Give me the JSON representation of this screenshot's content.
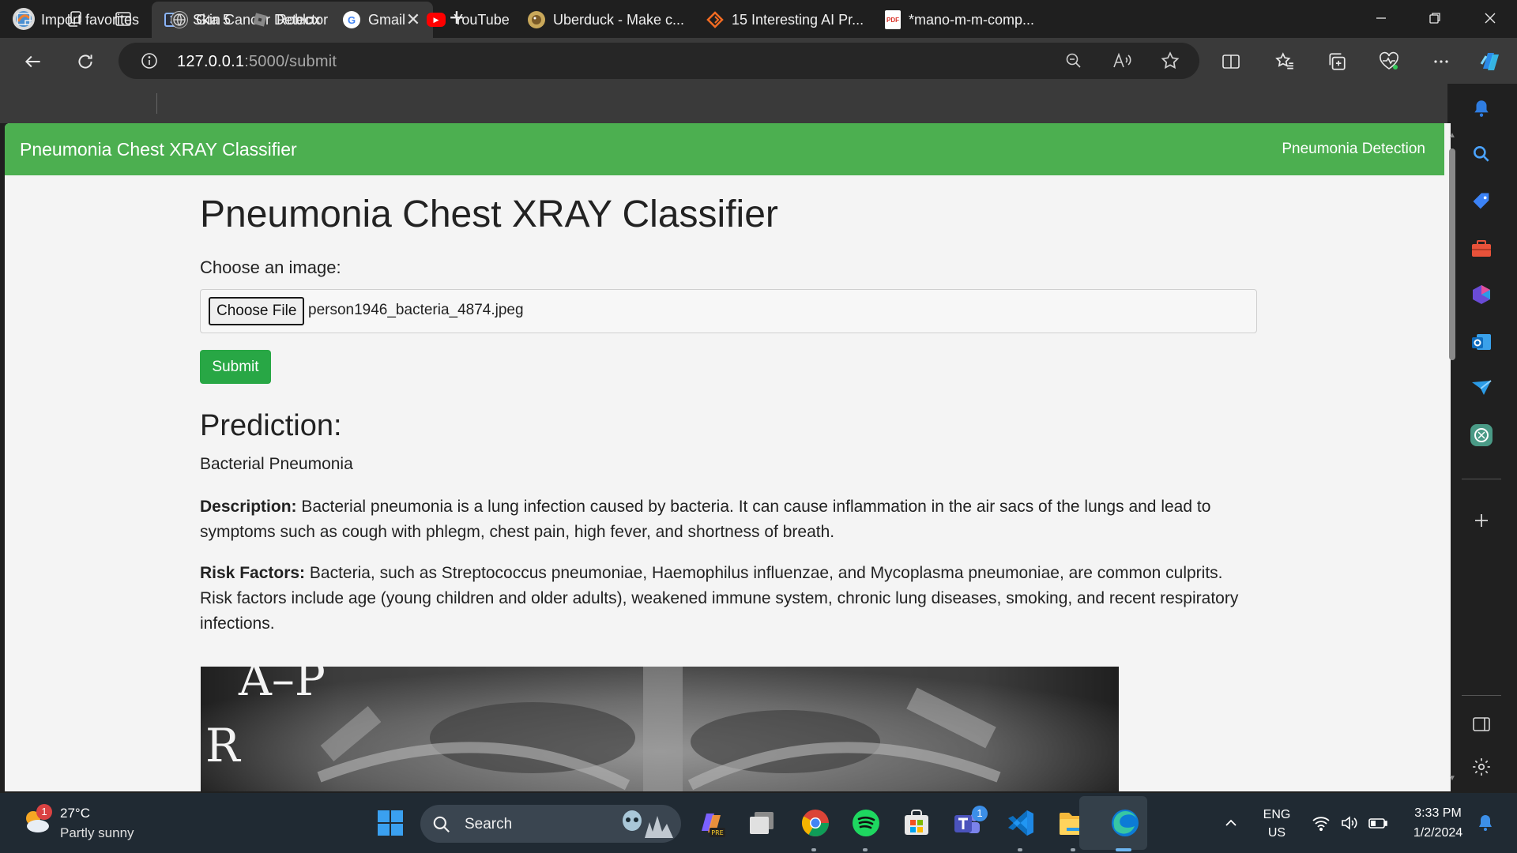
{
  "browser": {
    "tab": {
      "title": "Skin Cancer Detector",
      "close_glyph": "✕"
    },
    "new_tab_glyph": "+",
    "url": {
      "host": "127.0.0.1",
      "path": ":5000/submit"
    },
    "favorites": [
      {
        "label": "Import favorites",
        "icon": "import-icon"
      },
      {
        "label": "Gta 5",
        "icon": "globe-icon"
      },
      {
        "label": "Roblox",
        "icon": "roblox-icon"
      },
      {
        "label": "Gmail",
        "icon": "google-icon"
      },
      {
        "label": "YouTube",
        "icon": "youtube-icon"
      },
      {
        "label": "Uberduck - Make c...",
        "icon": "uberduck-icon"
      },
      {
        "label": "15 Interesting AI Pr...",
        "icon": "diamond-icon"
      },
      {
        "label": "*mano-m-m-comp...",
        "icon": "pdf-icon"
      }
    ]
  },
  "site": {
    "brand": "Pneumonia Chest XRAY Classifier",
    "nav_link": "Pneumonia Detection",
    "accent_color": "#4caf50"
  },
  "main": {
    "title": "Pneumonia Chest XRAY Classifier",
    "file_label": "Choose an image:",
    "choose_button": "Choose File",
    "file_name": "person1946_bacteria_4874.jpeg",
    "submit_label": "Submit",
    "prediction_heading": "Prediction:",
    "prediction_value": "Bacterial Pneumonia",
    "description_label": "Description:",
    "description_text": "Bacterial pneumonia is a lung infection caused by bacteria. It can cause inflammation in the air sacs of the lungs and lead to symptoms such as cough with phlegm, chest pain, high fever, and shortness of breath.",
    "risk_label": "Risk Factors:",
    "risk_text": "Bacteria, such as Streptococcus pneumoniae, Haemophilus influenzae, and Mycoplasma pneumoniae, are common culprits. Risk factors include age (young children and older adults), weakened immune system, chronic lung diseases, smoking, and recent respiratory infections.",
    "xray_marker_ap": "A–P",
    "xray_marker_r": "R"
  },
  "taskbar": {
    "weather_temp": "27°C",
    "weather_desc": "Partly sunny",
    "weather_badge": "1",
    "search_label": "Search",
    "teams_badge": "1",
    "lang_top": "ENG",
    "lang_bottom": "US",
    "time": "3:33 PM",
    "date": "1/2/2024"
  }
}
